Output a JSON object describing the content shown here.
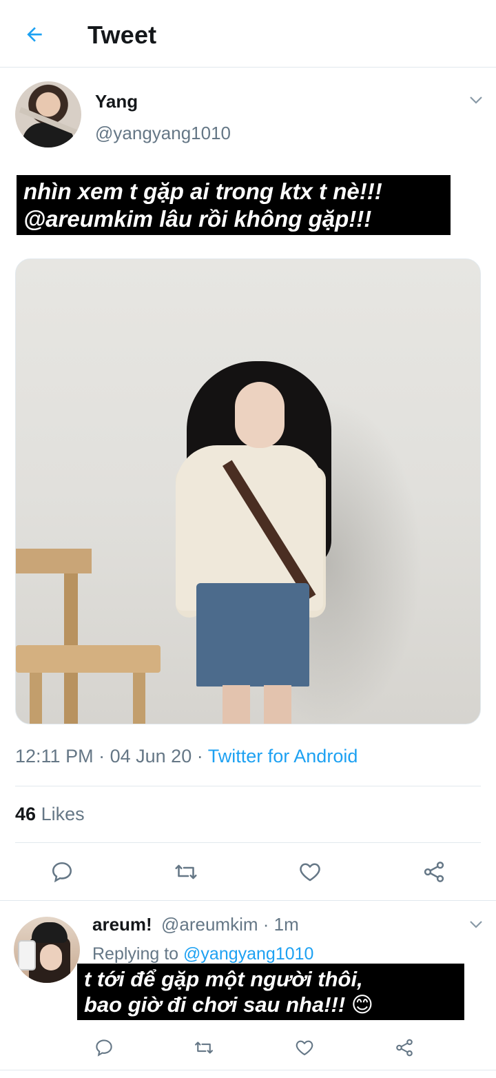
{
  "header": {
    "title": "Tweet",
    "back_icon": "arrow-left-icon",
    "accent": "#1da1f2"
  },
  "tweet": {
    "author_name": "Yang",
    "author_handle": "@yangyang1010",
    "caption_line1": "nhìn xem t gặp ai trong ktx t nè!!!",
    "caption_line2": "@areumkim lâu rồi không gặp!!!",
    "time": "12:11 PM",
    "separator": "·",
    "date": "04 Jun 20",
    "source": "Twitter for Android",
    "likes_count": "46",
    "likes_label": "Likes"
  },
  "reply": {
    "author_name": "areum!",
    "author_handle": "@areumkim",
    "time": "· 1m",
    "replying_label": "Replying to",
    "replying_to": "@yangyang1010",
    "caption_line1": "t tới để gặp một người thôi,",
    "caption_line2": "bao giờ đi chơi sau nha!!! 😊"
  },
  "actions": [
    "reply-icon",
    "retweet-icon",
    "like-icon",
    "share-icon"
  ],
  "colors": {
    "text": "#14171a",
    "secondary": "#657786",
    "link": "#1da1f2",
    "divider": "#e1e8ed"
  }
}
